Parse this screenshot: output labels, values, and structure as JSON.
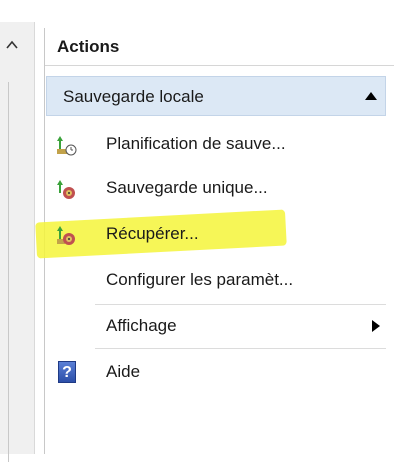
{
  "actions": {
    "title": "Actions",
    "section": {
      "label": "Sauvegarde locale",
      "collapse_icon": "triangle-up-icon"
    },
    "items": [
      {
        "label": "Planification de sauve...",
        "icon": "backup-schedule-icon"
      },
      {
        "label": "Sauvegarde unique...",
        "icon": "backup-once-icon"
      },
      {
        "label": "Récupérer...",
        "icon": "recover-icon"
      },
      {
        "label": "Configurer les paramèt...",
        "icon": ""
      },
      {
        "label": "Affichage",
        "icon": "",
        "submenu": true
      },
      {
        "label": "Aide",
        "icon": "help-icon"
      }
    ]
  },
  "help_glyph": "?",
  "colors": {
    "section_bg": "#dce8f5",
    "highlight": "#f4f53a",
    "help_blue": "#2c4fa8"
  }
}
